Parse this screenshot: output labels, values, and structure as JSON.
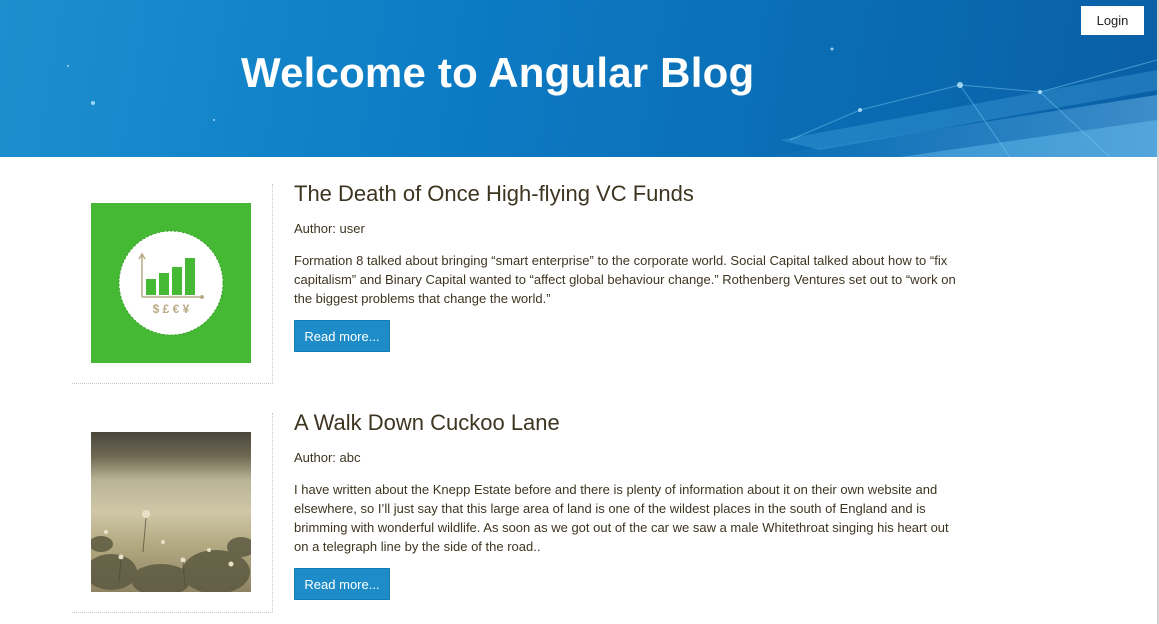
{
  "header": {
    "title": "Welcome to Angular Blog",
    "login_label": "Login"
  },
  "posts": [
    {
      "title": "The Death of Once High-flying VC Funds",
      "author": "Author: user",
      "excerpt": "Formation 8 talked about bringing “smart enterprise” to the corporate world. Social Capital talked about how to “fix capitalism” and Binary Capital wanted to “affect global behaviour change.” Rothenberg Ventures set out to “work on the biggest problems that change the world.”",
      "read_more": "Read more...",
      "image": {
        "icon": "finance-chart-icon",
        "currency_symbols": "$ £ € ¥",
        "bg_color": "#45b834"
      }
    },
    {
      "title": "A Walk Down Cuckoo Lane",
      "author": "Author: abc",
      "excerpt": "I have written about the Knepp Estate before and there is plenty of information about it on their own website and elsewhere, so I’ll just say that this large area of land is one of the wildest places in the south of England and is brimming with wonderful wildlife. As soon as we got out of the car we saw a male Whitethroat singing his heart out on a telegraph line by the side of the road..",
      "read_more": "Read more...",
      "image": {
        "icon": "meadow-photo"
      }
    }
  ],
  "colors": {
    "header_blue": "#0c7bc4",
    "button_blue": "#1e8cc9",
    "text_brown": "#3d3520"
  }
}
